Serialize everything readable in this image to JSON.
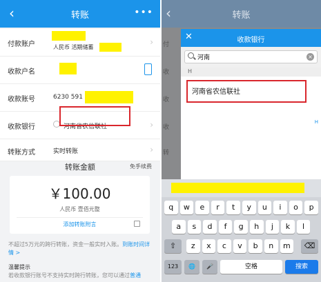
{
  "left": {
    "nav": {
      "back_glyph": "‹",
      "title": "转账",
      "more_glyph": "•••"
    },
    "rows": [
      {
        "label": "付款账户",
        "value": "人民币 活期储蓄",
        "icon": "chevron-right-icon"
      },
      {
        "label": "收款户名",
        "icon": "contacts-book-icon"
      },
      {
        "label": "收款账号",
        "value": "6230 591"
      },
      {
        "label": "收款银行",
        "value": "河南省农信联社",
        "icon": "chevron-right-icon"
      },
      {
        "label": "转账方式",
        "value": "实时转账",
        "icon": "chevron-right-icon"
      }
    ],
    "amount_header": "转账金额",
    "free_fee": "免手续费",
    "amount": "￥100.00",
    "amount_caption": "人民币 壹佰元整",
    "add_note": "添加转账附言",
    "info_text": "不超过5万元的跨行转账，资金一般实时入账。",
    "info_link": "到账时间详情 >",
    "tips_title": "温馨提示",
    "tips_body": "若收款银行账号不支持实时跨行转账，您可以通过",
    "tips_link": "普通"
  },
  "right": {
    "nav": {
      "back_glyph": "‹",
      "title": "转账"
    },
    "modal": {
      "close_glyph": "✕",
      "title": "收款银行",
      "search_value": "河南",
      "clear_glyph": "×",
      "section_letter": "H",
      "result": "河南省农信联社",
      "index_letter": "H"
    },
    "keyboard": {
      "row1": [
        "q",
        "w",
        "e",
        "r",
        "t",
        "y",
        "u",
        "i",
        "o",
        "p"
      ],
      "row2": [
        "a",
        "s",
        "d",
        "f",
        "g",
        "h",
        "j",
        "k",
        "l"
      ],
      "row3": [
        "z",
        "x",
        "c",
        "v",
        "b",
        "n",
        "m"
      ],
      "shift": "⇧",
      "delete": "⌫",
      "num": "123",
      "globe": "🌐",
      "mic": "🎤",
      "space": "空格",
      "search": "搜索"
    }
  },
  "colors": {
    "brand_blue": "#1b94ea",
    "highlight_box": "#d9262c",
    "redaction": "#fff200"
  }
}
